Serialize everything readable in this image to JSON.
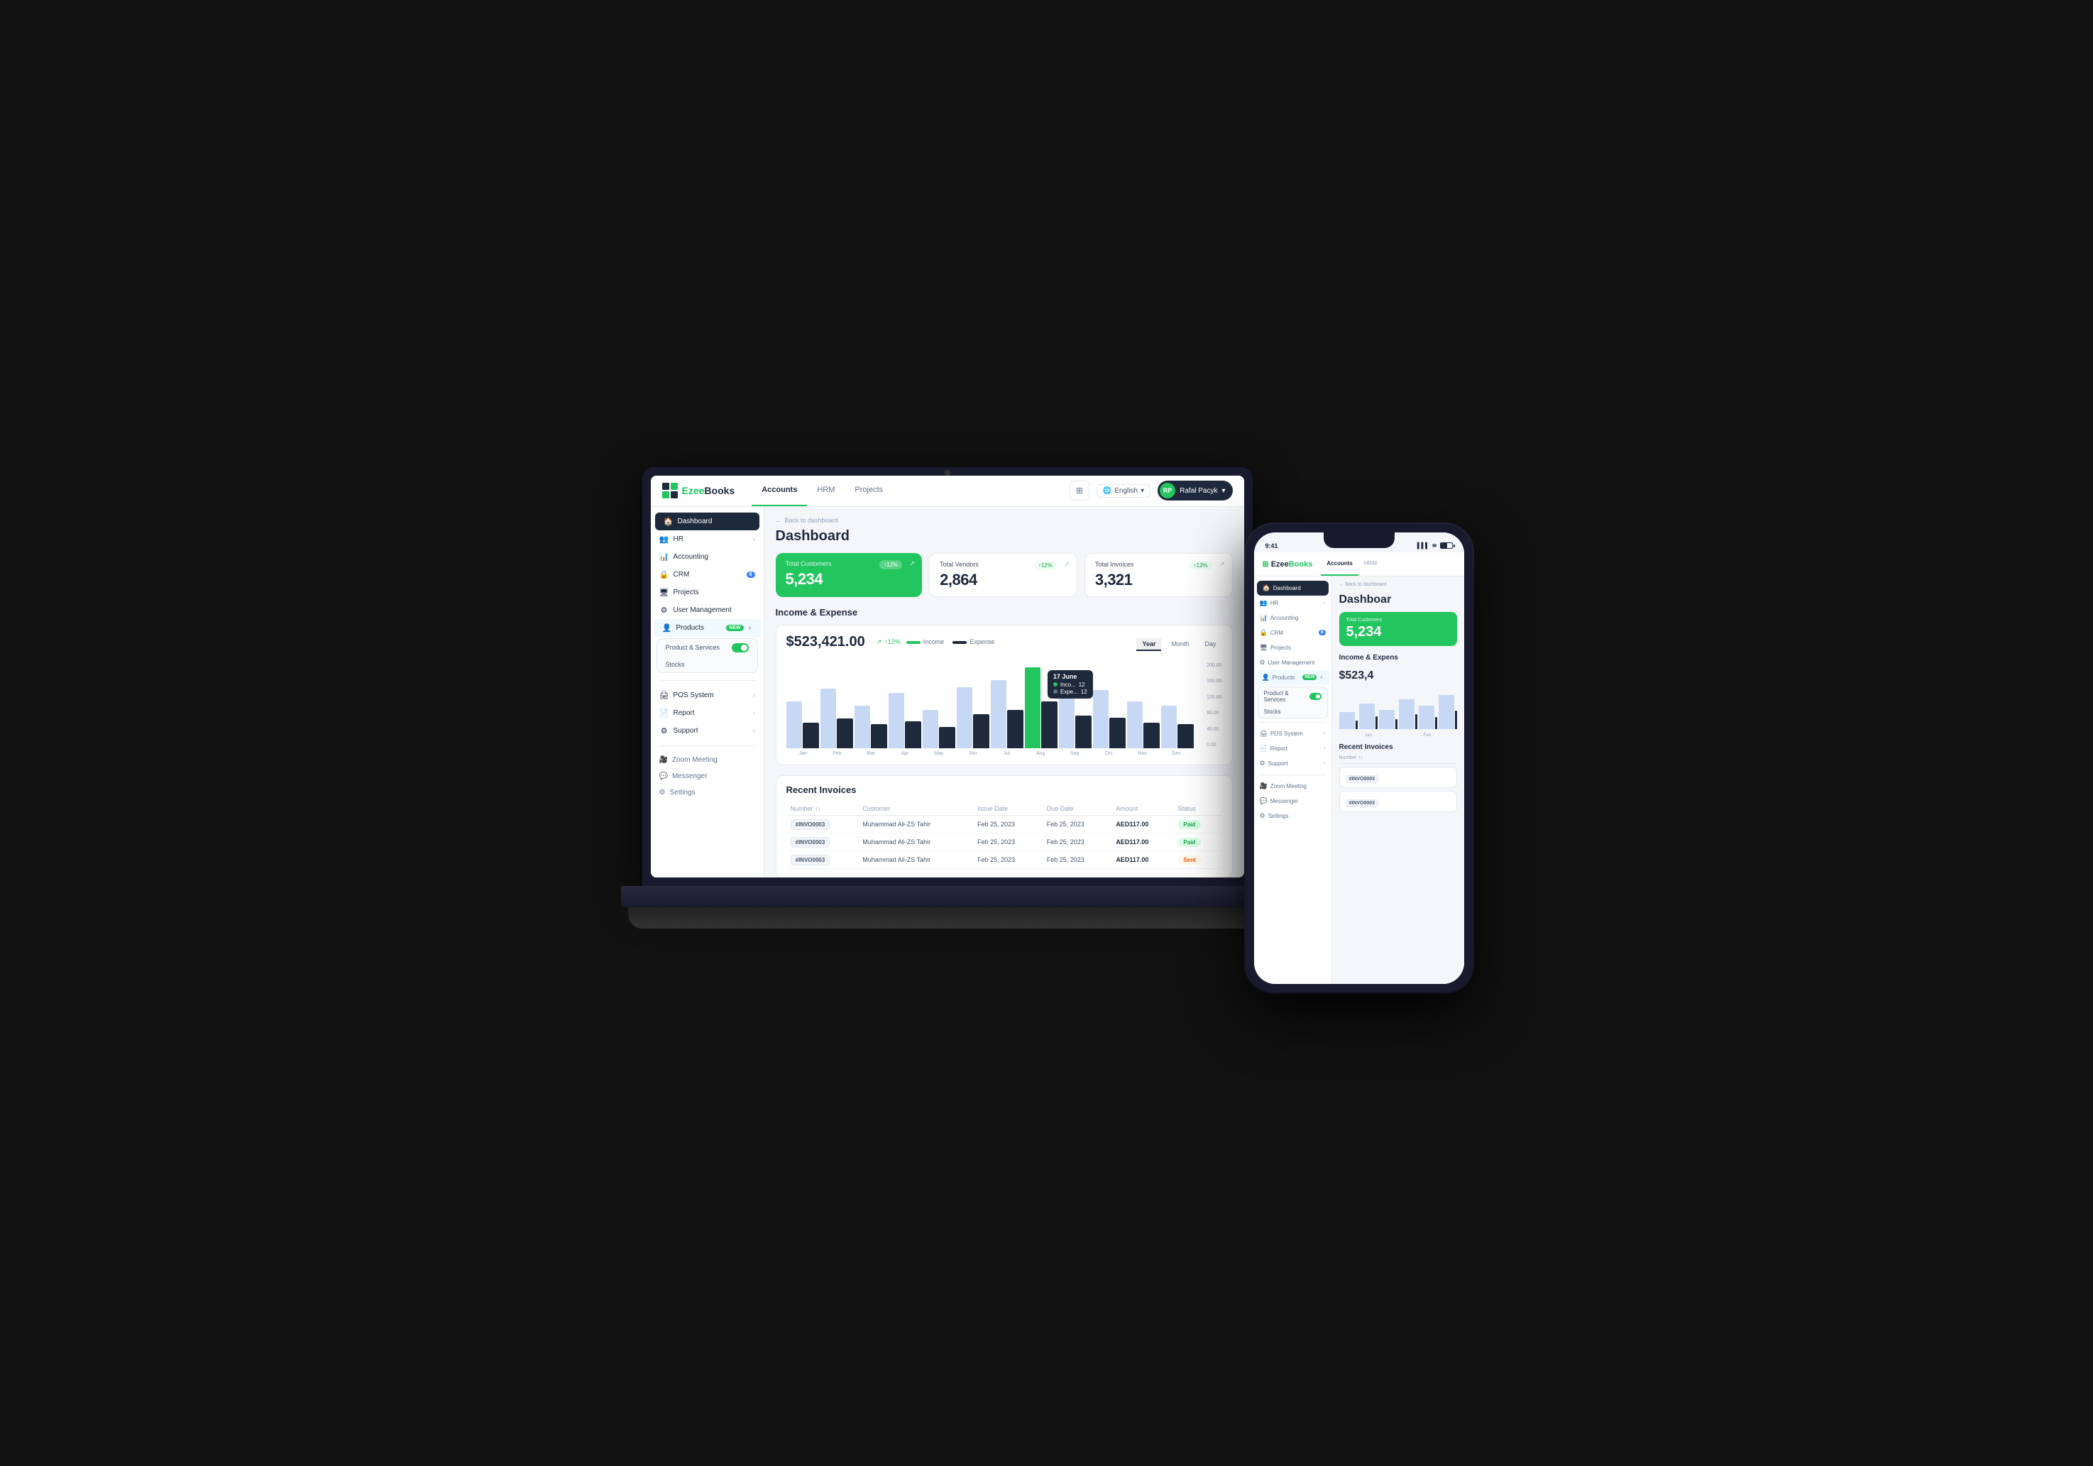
{
  "app": {
    "logo_text_normal": "Ezee",
    "logo_text_bold": "Books",
    "nav_tabs": [
      {
        "label": "Accounts",
        "active": true
      },
      {
        "label": "HRM",
        "active": false
      },
      {
        "label": "Projects",
        "active": false
      }
    ],
    "language": "English",
    "user_name": "Rafał Pacyk"
  },
  "sidebar": {
    "items": [
      {
        "label": "Dashboard",
        "active": true,
        "icon": "🏠"
      },
      {
        "label": "HR",
        "icon": "👥",
        "has_arrow": true
      },
      {
        "label": "Accounting",
        "icon": "📊"
      },
      {
        "label": "CRM",
        "icon": "🔒",
        "badge": "8",
        "badge_color": "blue"
      },
      {
        "label": "Projects",
        "icon": "🖥"
      },
      {
        "label": "User Management",
        "icon": "⚙"
      },
      {
        "label": "Products",
        "icon": "👤",
        "badge": "NEW",
        "expanded": true
      }
    ],
    "submenu": [
      {
        "label": "Product & Services",
        "has_toggle": true
      },
      {
        "label": "Stocks"
      }
    ],
    "bottom_items": [
      {
        "label": "POS System",
        "icon": "🖨",
        "has_arrow": true
      },
      {
        "label": "Report",
        "icon": "📄",
        "has_arrow": true
      },
      {
        "label": "Support",
        "icon": "⚙",
        "has_arrow": true
      }
    ],
    "utility_items": [
      {
        "label": "Zoom Meeting",
        "icon": "🎥"
      },
      {
        "label": "Messenger",
        "icon": "💬"
      },
      {
        "label": "Settings",
        "icon": "⚙"
      }
    ]
  },
  "main": {
    "breadcrumb": "Back to dashboard",
    "page_title": "Dashboard",
    "stats": [
      {
        "label": "Total Customers",
        "value": "5,234",
        "badge": "↑12%",
        "style": "green"
      },
      {
        "label": "Total Vendors",
        "value": "2,864",
        "badge": "↑12%",
        "style": "white"
      },
      {
        "label": "Total Invoices",
        "value": "3,321",
        "badge": "↑12%",
        "style": "white"
      }
    ],
    "income_expense": {
      "title": "Income & Expense",
      "amount": "$523,421.00",
      "growth": "↑12%",
      "legend_income": "Income",
      "legend_expense": "Expense",
      "tabs": [
        "Year",
        "Month",
        "Day"
      ],
      "active_tab": "Year",
      "y_labels": [
        "200.00",
        "160.00",
        "120.00",
        "80.00",
        "40.00",
        "0.00"
      ],
      "x_labels": [
        "Jan",
        "Feb",
        "Mar",
        "Apr",
        "May",
        "Jun",
        "Jul",
        "Aug",
        "Sep",
        "Oct",
        "Nov",
        "Dec"
      ],
      "tooltip": {
        "date": "17 June",
        "income_label": "Income",
        "income_value": "12",
        "expense_label": "Expense",
        "expense_value": "12"
      },
      "bars": [
        {
          "income": 55,
          "expense": 30
        },
        {
          "income": 70,
          "expense": 35
        },
        {
          "income": 50,
          "expense": 28
        },
        {
          "income": 65,
          "expense": 32
        },
        {
          "income": 45,
          "expense": 25
        },
        {
          "income": 72,
          "expense": 40
        },
        {
          "income": 80,
          "expense": 45
        },
        {
          "income": 95,
          "expense": 55,
          "highlight": true
        },
        {
          "income": 60,
          "expense": 38
        },
        {
          "income": 68,
          "expense": 36
        },
        {
          "income": 55,
          "expense": 30
        },
        {
          "income": 50,
          "expense": 28
        }
      ]
    },
    "recent_invoices": {
      "title": "Recent Invoices",
      "columns": [
        "Number",
        "Customer",
        "Issue Date",
        "Due Date",
        "Amount",
        "Status"
      ],
      "rows": [
        {
          "number": "#INVO0003",
          "customer": "Muhammad Ali-ZS Tahir",
          "issue_date": "Feb 25, 2023",
          "due_date": "Feb 25, 2023",
          "amount": "AED117.00",
          "status": "Paid"
        },
        {
          "number": "#INVO0003",
          "customer": "Muhammad Ali-ZS Tahir",
          "issue_date": "Feb 25, 2023",
          "due_date": "Feb 25, 2023",
          "amount": "AED117.00",
          "status": "Paid"
        },
        {
          "number": "#INVO0003",
          "customer": "Muhammad Ali-ZS Tahir",
          "issue_date": "Feb 25, 2023",
          "due_date": "Feb 25, 2023",
          "amount": "AED117.00",
          "status": "Sent"
        }
      ]
    }
  },
  "phone": {
    "status_time": "9:41",
    "nav_tabs": [
      {
        "label": "Accounts",
        "active": true
      },
      {
        "label": "HRM",
        "active": false
      }
    ],
    "breadcrumb": "← Back to dashboard",
    "page_title": "Dashboar",
    "stat_label": "Total Customers",
    "stat_value": "5,234",
    "income_title": "Income & Expens",
    "income_amount": "$523,4",
    "invoices_title": "Recent Invoices",
    "invoice_col": "Number",
    "invoice_rows": [
      "#INVO0003",
      "#INVO0003"
    ],
    "sidebar": {
      "items": [
        {
          "label": "Dashboard",
          "active": true,
          "icon": "🏠"
        },
        {
          "label": "HR",
          "icon": "👥",
          "has_arrow": true
        },
        {
          "label": "Accounting",
          "icon": "📊"
        },
        {
          "label": "CRM",
          "icon": "🔒",
          "badge": "8"
        },
        {
          "label": "Projects",
          "icon": "🖥"
        },
        {
          "label": "User Management",
          "icon": "⚙"
        },
        {
          "label": "Products",
          "icon": "👤",
          "badge": "NEW",
          "expanded": true
        }
      ]
    }
  }
}
